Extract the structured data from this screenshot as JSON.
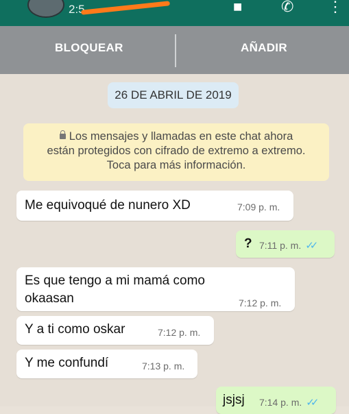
{
  "header": {
    "status_time": "2:5",
    "icons": [
      "avatar",
      "video-call-icon",
      "voice-call-icon",
      "more-options-icon"
    ]
  },
  "actions": {
    "block_label": "BLOQUEAR",
    "add_label": "AÑADIR"
  },
  "chat": {
    "date": "26 DE ABRIL DE 2019",
    "encryption_notice": {
      "line1": "Los mensajes y llamadas en este chat ahora",
      "line2": "están protegidos con cifrado de extremo a extremo.",
      "line3": "Toca para más información."
    },
    "messages": [
      {
        "direction": "in",
        "text": "Me equivoqué  de nunero XD",
        "time": "7:09 p. m."
      },
      {
        "direction": "out",
        "text": "?",
        "time": "7:11 p. m.",
        "ticks": "✓✓"
      },
      {
        "direction": "in",
        "text_line1": "Es que  tengo a mi mamá  como",
        "text_line2": "okaasan",
        "time": "7:12 p. m."
      },
      {
        "direction": "in",
        "text": "Y a ti como oskar",
        "time": "7:12 p. m."
      },
      {
        "direction": "in",
        "text": "Y me  confundí",
        "time": "7:13 p. m."
      },
      {
        "direction": "out",
        "text": "jsjsj",
        "time": "7:14 p. m.",
        "ticks": "✓✓"
      }
    ],
    "colors": {
      "header": "#0f6f5e",
      "actionbar": "#8f9295",
      "outgoing_bubble": "#dcf8c6",
      "incoming_bubble": "#ffffff",
      "notice": "#fbf1c4",
      "date_pill": "#dcebf5",
      "read_ticks": "#4fb6ec"
    }
  }
}
